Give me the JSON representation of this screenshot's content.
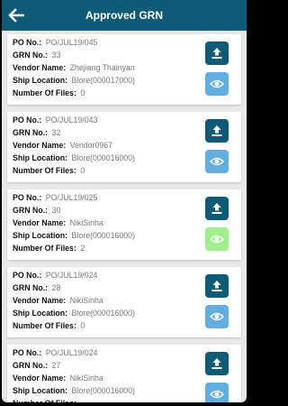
{
  "header": {
    "title": "Approved GRN",
    "back_icon": "arrow-left-icon",
    "background": "#0e5b77"
  },
  "labels": {
    "po": "PO No.:",
    "grn": "GRN No.:",
    "vendor": "Vendor Name:",
    "location": "Ship Location:",
    "files": "Number Of Files:"
  },
  "icons": {
    "upload": "upload-icon",
    "view": "eye-icon"
  },
  "colors": {
    "upload_button": "#0e5b77",
    "view_button_no_files": "#63aee0",
    "view_button_with_files": "#9ff08c"
  },
  "items": [
    {
      "po": "PO/JUL19/045",
      "grn": "33",
      "vendor": "Zhejiang Thainyan",
      "location": "Blore(000017000)",
      "files": "0"
    },
    {
      "po": "PO/JUL19/043",
      "grn": "32",
      "vendor": "Vendor0967",
      "location": "Blore(000016000)",
      "files": "0"
    },
    {
      "po": "PO/JUL19/025",
      "grn": "30",
      "vendor": "NikiSinha",
      "location": "Blore(000016000)",
      "files": "2"
    },
    {
      "po": "PO/JUL19/024",
      "grn": "28",
      "vendor": "NikiSinha",
      "location": "Blore(000016000)",
      "files": "0"
    },
    {
      "po": "PO/JUL19/024",
      "grn": "27",
      "vendor": "NikiSinha",
      "location": "Blore(000016000)",
      "files": ""
    }
  ]
}
